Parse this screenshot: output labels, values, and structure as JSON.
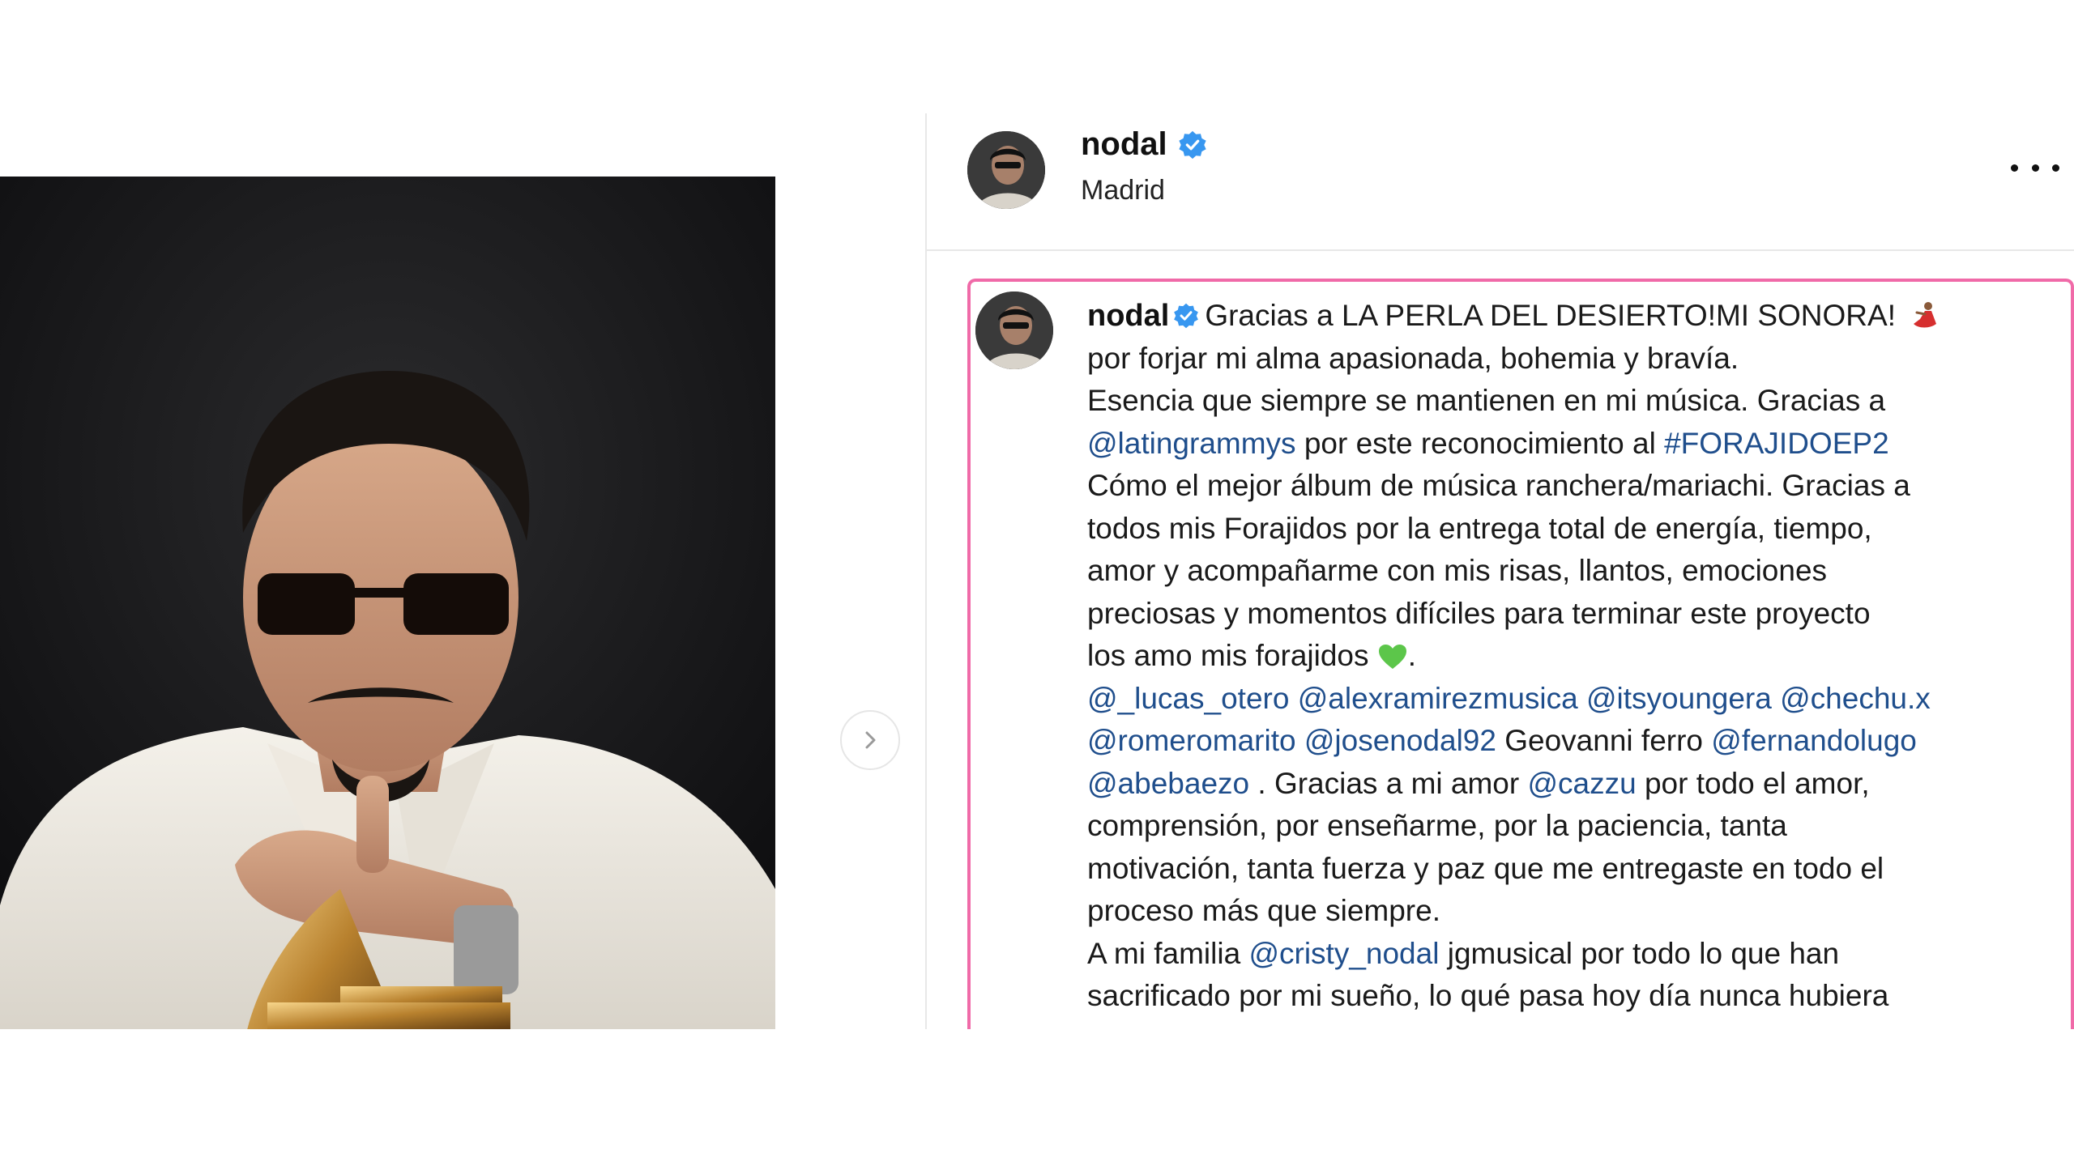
{
  "post": {
    "username": "nodal",
    "location": "Madrid"
  },
  "caption": {
    "username": "nodal",
    "lines": [
      [
        {
          "t": "Gracias a LA PERLA DEL DESIERTO!MI SONORA! "
        }
      ],
      [
        {
          "t": "por forjar mi alma apasionada, bohemia y bravía."
        }
      ],
      [
        {
          "t": "Esencia que siempre se mantienen en mi música. Gracias a"
        }
      ],
      [
        {
          "m": "@latingrammys"
        },
        {
          "t": " por este reconocimiento al "
        },
        {
          "m": "#FORAJIDOEP2"
        }
      ],
      [
        {
          "t": "Cómo el mejor álbum de música ranchera/mariachi. Gracias a"
        }
      ],
      [
        {
          "t": "todos mis Forajidos por la entrega total de energía, tiempo,"
        }
      ],
      [
        {
          "t": "amor y acompañarme con mis risas, llantos, emociones"
        }
      ],
      [
        {
          "t": "preciosas y momentos difíciles para terminar este proyecto"
        }
      ],
      [
        {
          "t": "los amo mis forajidos "
        }
      ],
      [
        {
          "m": "@_lucas_otero"
        },
        {
          "t": " "
        },
        {
          "m": "@alexramirezmusica"
        },
        {
          "t": " "
        },
        {
          "m": "@itsyoungera"
        },
        {
          "t": " "
        },
        {
          "m": "@chechu.x"
        }
      ],
      [
        {
          "m": "@romeromarito"
        },
        {
          "t": " "
        },
        {
          "m": "@josenodal92"
        },
        {
          "t": " Geovanni ferro "
        },
        {
          "m": "@fernandolugo"
        }
      ],
      [
        {
          "m": "@abebaezo"
        },
        {
          "t": " . Gracias a mi amor "
        },
        {
          "m": "@cazzu"
        },
        {
          "t": " por todo el amor,"
        }
      ],
      [
        {
          "t": "comprensión, por enseñarme, por la paciencia, tanta"
        }
      ],
      [
        {
          "t": "motivación, tanta fuerza y paz que me entregaste en todo el"
        }
      ],
      [
        {
          "t": "proceso más que siempre."
        }
      ],
      [
        {
          "t": "A mi familia "
        },
        {
          "m": "@cristy_nodal"
        },
        {
          "t": " jgmusical por todo lo que han"
        }
      ],
      [
        {
          "t": "sacrificado por mi sueño, lo qué pasa hoy día nunca hubiera"
        }
      ]
    ]
  },
  "icons": {
    "verified": "verified-badge-icon",
    "more": "more-options-icon",
    "next": "chevron-right-icon"
  },
  "colors": {
    "verified": "#3897f0",
    "mention": "#1f4e8c",
    "highlight_border": "#f06aa8"
  }
}
